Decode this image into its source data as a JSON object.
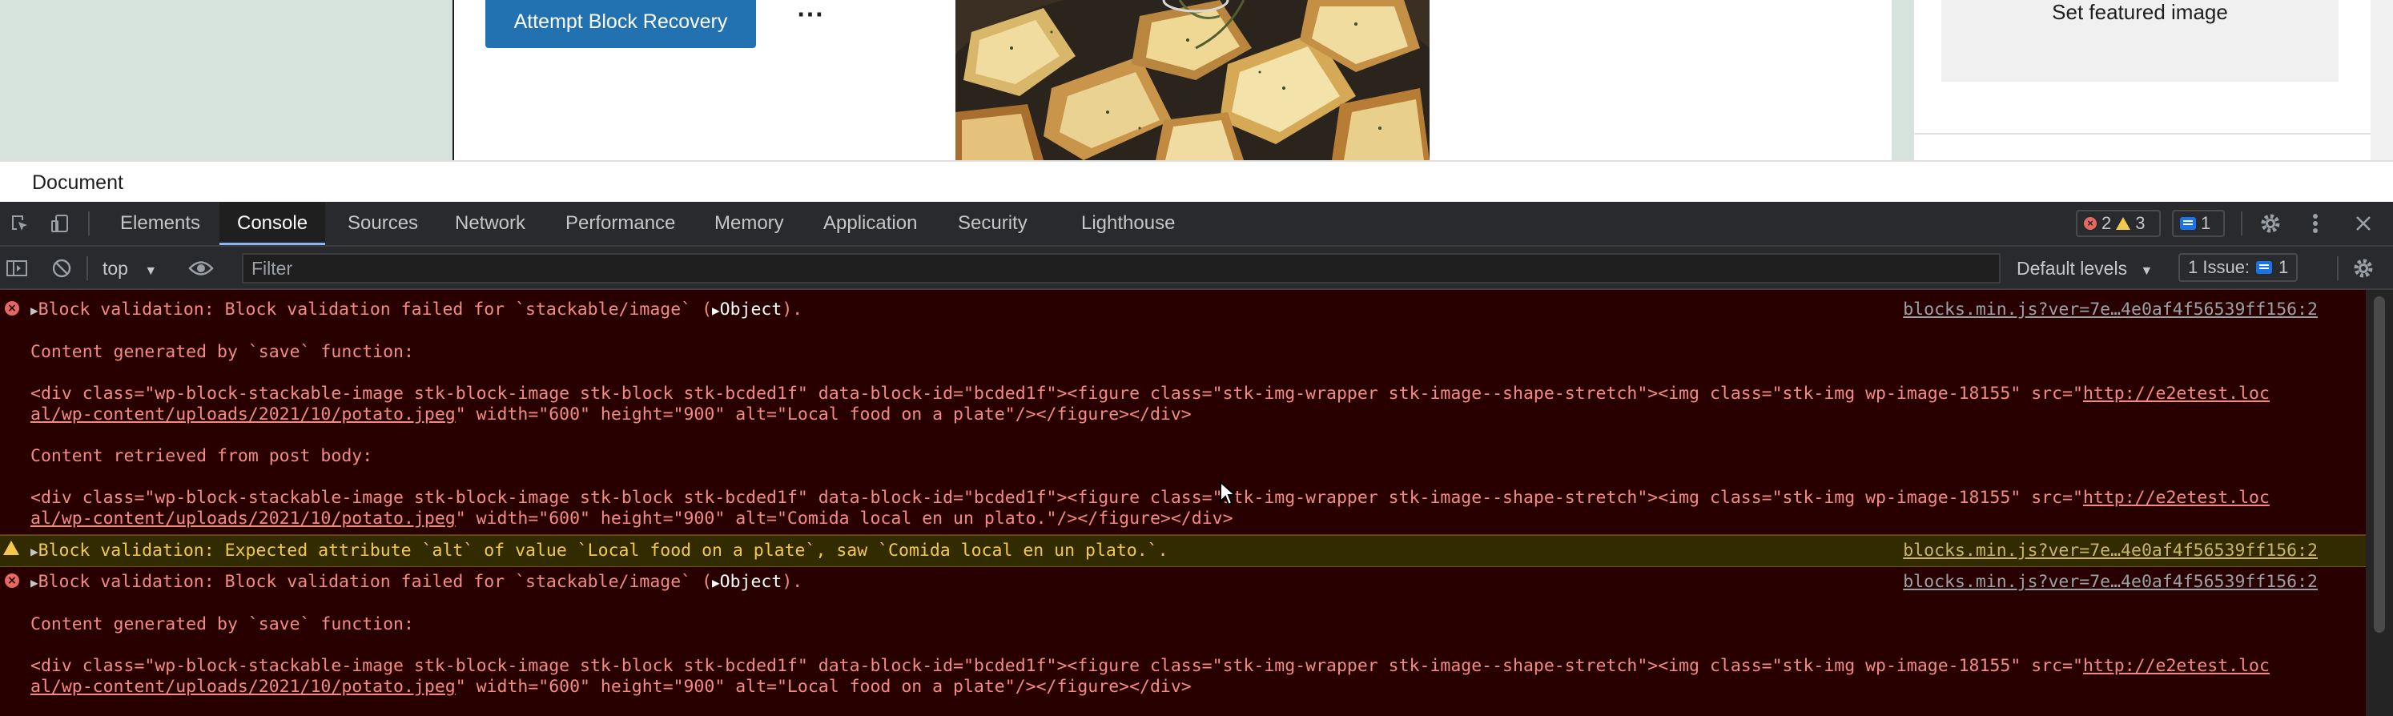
{
  "editor": {
    "recovery_button": "Attempt Block Recovery",
    "more_button": "⋯",
    "featured_image_button": "Set featured image"
  },
  "status_bar": {
    "breadcrumb": "Document"
  },
  "devtools": {
    "tabs": [
      "Elements",
      "Console",
      "Sources",
      "Network",
      "Performance",
      "Memory",
      "Application",
      "Security",
      "Lighthouse"
    ],
    "active_tab": "Console",
    "counts": {
      "errors": "2",
      "warnings": "3",
      "messages": "1"
    },
    "toolbar": {
      "context": "top",
      "filter_placeholder": "Filter",
      "levels": "Default levels",
      "issues_label": "1 Issue:",
      "issues_count": "1"
    }
  },
  "console": {
    "messages": [
      {
        "level": "error",
        "head_pre": "Block validation: Block validation failed for `stackable/image` (",
        "object": "Object",
        "head_post": ").",
        "source": "blocks.min.js?ver=7e…4e0af4f56539ff156:2",
        "label1": "Content generated by `save` function:",
        "code1_a": "<div class=\"wp-block-stackable-image stk-block-image stk-block stk-bcded1f\" data-block-id=\"bcded1f\"><figure class=\"stk-img-wrapper stk-image--shape-stretch\"><img class=\"stk-img wp-image-18155\" src=\"",
        "link1_a": "http://e2etest.loc",
        "link1_b": "al/wp-content/uploads/2021/10/potato.jpeg",
        "code1_b": "\" width=\"600\" height=\"900\" alt=\"Local food on a plate\"/></figure></div>",
        "label2": "Content retrieved from post body:",
        "code2_a": "<div class=\"wp-block-stackable-image stk-block-image stk-block stk-bcded1f\" data-block-id=\"bcded1f\"><figure class=\"stk-img-wrapper stk-image--shape-stretch\"><img class=\"stk-img wp-image-18155\" src=\"",
        "link2_a": "http://e2etest.loc",
        "link2_b": "al/wp-content/uploads/2021/10/potato.jpeg",
        "code2_b": "\" width=\"600\" height=\"900\" alt=\"Comida local en un plato.\"/></figure></div>"
      },
      {
        "level": "warning",
        "head_pre": "Block validation: Expected attribute `alt` of value `Local food on a plate`, saw `Comida local en un plato.`.",
        "source": "blocks.min.js?ver=7e…4e0af4f56539ff156:2"
      },
      {
        "level": "error",
        "head_pre": "Block validation: Block validation failed for `stackable/image` (",
        "object": "Object",
        "head_post": ").",
        "source": "blocks.min.js?ver=7e…4e0af4f56539ff156:2",
        "label1": "Content generated by `save` function:",
        "code1_a": "<div class=\"wp-block-stackable-image stk-block-image stk-block stk-bcded1f\" data-block-id=\"bcded1f\"><figure class=\"stk-img-wrapper stk-image--shape-stretch\"><img class=\"stk-img wp-image-18155\" src=\"",
        "link1_a": "http://e2etest.loc",
        "link1_b": "al/wp-content/uploads/2021/10/potato.jpeg",
        "code1_b": "\" width=\"600\" height=\"900\" alt=\"Local food on a plate\"/></figure></div>"
      }
    ]
  },
  "colors": {
    "wp_button": "#2271b1",
    "editor_bg": "#d6e3dd",
    "console_error_bg": "#290000",
    "console_error_text": "#f28b82",
    "console_warning_bg": "#332b00",
    "console_warning_text": "#f2c94c",
    "devtools_tab_accent": "#8ab4f8"
  }
}
